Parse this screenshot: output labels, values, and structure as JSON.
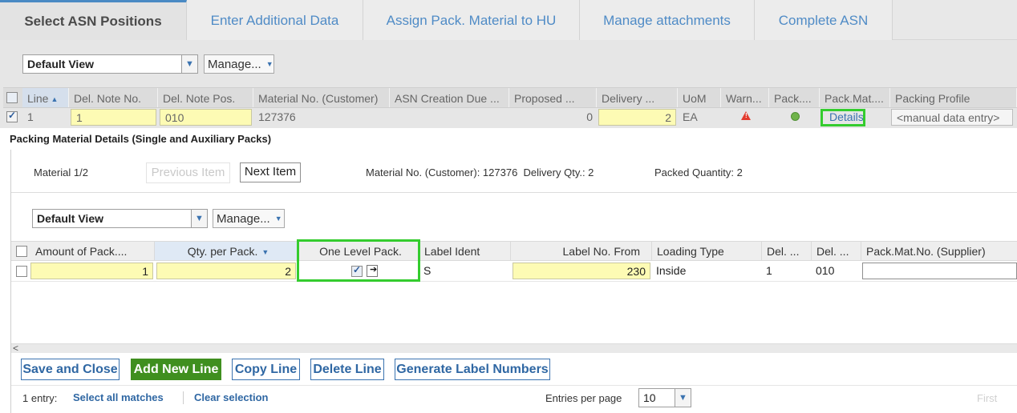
{
  "tabs": [
    {
      "label": "Select ASN Positions"
    },
    {
      "label": "Enter Additional Data"
    },
    {
      "label": "Assign Pack. Material to HU"
    },
    {
      "label": "Manage attachments"
    },
    {
      "label": "Complete ASN"
    }
  ],
  "toolbar": {
    "view": "Default View",
    "manage": "Manage..."
  },
  "positions": {
    "headers": [
      "Line",
      "Del. Note No.",
      "Del. Note Pos.",
      "Material No. (Customer)",
      "ASN Creation Due ...",
      "Proposed ...",
      "Delivery ...",
      "UoM",
      "Warn...",
      "Pack....",
      "Pack.Mat....",
      "Packing Profile"
    ],
    "row": {
      "line": "1",
      "del_note_no": "1",
      "del_note_pos": "010",
      "material": "127376",
      "asn_due": "",
      "proposed": "0",
      "delivery": "2",
      "uom": "EA",
      "details_link": "Details",
      "packing_profile": "<manual data entry>"
    }
  },
  "panel": {
    "title": "Packing Material Details (Single and Auxiliary Packs)",
    "material_counter": "Material 1/2",
    "prev_button": "Previous Item",
    "next_button": "Next Item",
    "material_info": "Material No. (Customer): 127376  Delivery Qty.: 2",
    "packed_info": "Packed Quantity: 2",
    "view": "Default View",
    "manage": "Manage...",
    "headers": [
      "Amount of Pack....",
      "Qty. per Pack.",
      "One Level Pack.",
      "Label Ident",
      "Label No. From",
      "Loading Type",
      "Del. ...",
      "Del. ...",
      "Pack.Mat.No. (Supplier)"
    ],
    "row": {
      "amount": "1",
      "qty_per_pack": "2",
      "label_ident": "S",
      "label_no_from": "230",
      "loading_type": "Inside",
      "del1": "1",
      "del2": "010",
      "pack_mat_supplier": ""
    },
    "actions": {
      "save_close": "Save and Close",
      "add_line": "Add New Line",
      "copy_line": "Copy Line",
      "delete_line": "Delete Line",
      "generate_labels": "Generate Label Numbers"
    },
    "footer": {
      "entries": "1 entry:",
      "select_all": "Select all matches",
      "clear": "Clear selection",
      "entries_per_page_label": "Entries per page",
      "entries_per_page": "10",
      "first": "First"
    }
  },
  "colors": {
    "accent": "#3b73b0",
    "highlight": "#34cc2e",
    "editable_yellow": "#fdfbb4",
    "primary_button": "#3f8f1f",
    "warning": "#e23b2e",
    "ok_status": "#6fb34a"
  },
  "icons": [
    "chevron-down-icon",
    "sort-ascending-icon",
    "sort-descending-icon",
    "warning-icon",
    "status-ok-icon",
    "scroll-left-icon",
    "open-detail-icon"
  ]
}
